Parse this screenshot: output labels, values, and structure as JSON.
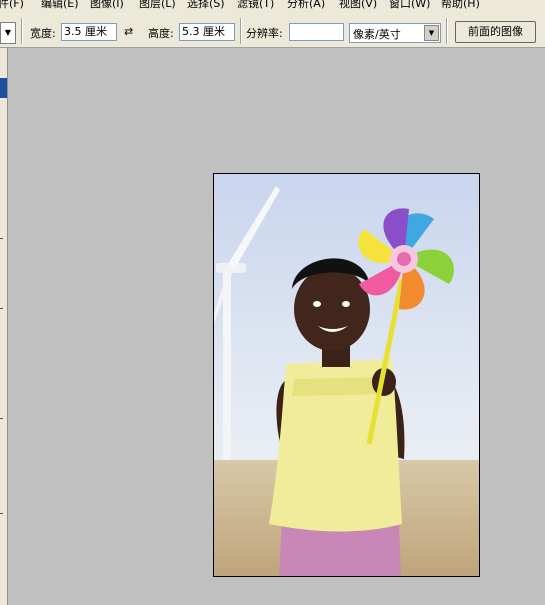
{
  "menubar": {
    "items": [
      {
        "label": "件(F)",
        "name": "menu-file"
      },
      {
        "label": "编辑(E)",
        "name": "menu-edit"
      },
      {
        "label": "图像(I)",
        "name": "menu-image"
      },
      {
        "label": "图层(L)",
        "name": "menu-layer"
      },
      {
        "label": "选择(S)",
        "name": "menu-select"
      },
      {
        "label": "滤镜(T)",
        "name": "menu-filter"
      },
      {
        "label": "分析(A)",
        "name": "menu-analysis"
      },
      {
        "label": "视图(V)",
        "name": "menu-view"
      },
      {
        "label": "窗口(W)",
        "name": "menu-window"
      },
      {
        "label": "帮助(H)",
        "name": "menu-help"
      }
    ]
  },
  "toolbar": {
    "width_label": "宽度:",
    "width_value": "3.5 厘米",
    "swap_icon": "⇄",
    "height_label": "高度:",
    "height_value": "5.3 厘米",
    "resolution_label": "分辨率:",
    "resolution_value": "",
    "unit_selected": "像素/英寸",
    "front_image_button": "前面的图像"
  },
  "colors": {
    "menubar_bg": "#ece9d8",
    "canvas_bg": "#c0c0c0"
  },
  "document": {
    "image_icon": "photo-of-child-with-pinwheel"
  }
}
